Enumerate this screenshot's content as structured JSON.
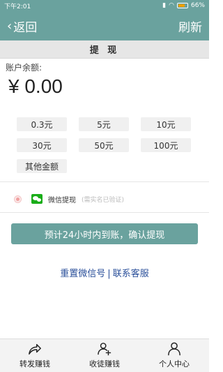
{
  "status_bar": {
    "time": "下午2:01",
    "battery": "66%"
  },
  "app_bar": {
    "back_label": "返回",
    "refresh_label": "刷新"
  },
  "sub_header": {
    "title": "提 现"
  },
  "balance": {
    "label": "账户余额:",
    "value": "¥ 0.00"
  },
  "amount_options": [
    "0.3元",
    "5元",
    "10元",
    "30元",
    "50元",
    "100元",
    "其他金额"
  ],
  "wechat": {
    "label": "微信提现",
    "note": "(需实名已验证)"
  },
  "confirm_button": {
    "label": "预计24小时内到账，确认提现"
  },
  "links": {
    "reset": "重置微信号",
    "separator": "|",
    "contact": "联系客服"
  },
  "bottom_nav": [
    {
      "label": "转发赚钱",
      "icon": "share-icon"
    },
    {
      "label": "收徒赚钱",
      "icon": "add-user-icon"
    },
    {
      "label": "个人中心",
      "icon": "user-icon"
    }
  ],
  "colors": {
    "primary": "#6aa29e",
    "link": "#2a4f9a",
    "wechat_green": "#1aad19"
  }
}
